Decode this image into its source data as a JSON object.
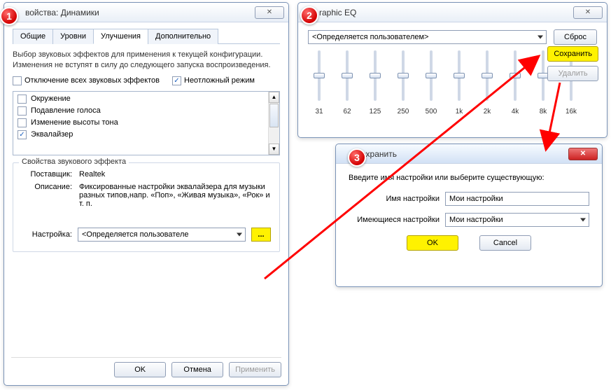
{
  "badges": [
    "1",
    "2",
    "3"
  ],
  "win1": {
    "title": "войства: Динамики",
    "close": "✕",
    "tabs": [
      "Общие",
      "Уровни",
      "Улучшения",
      "Дополнительно"
    ],
    "active_tab": 2,
    "intro": "Выбор звуковых эффектов для применения к текущей конфигурации. Изменения не вступят в силу до следующего запуска воспроизведения.",
    "opt_disable": "Отключение всех звуковых эффектов",
    "opt_urgent": "Неотложный режим",
    "effects": [
      {
        "label": "Окружение",
        "checked": false
      },
      {
        "label": "Подавление голоса",
        "checked": false
      },
      {
        "label": "Изменение высоты тона",
        "checked": false
      },
      {
        "label": "Эквалайзер",
        "checked": true
      }
    ],
    "group_title": "Свойства звукового эффекта",
    "vendor_k": "Поставщик:",
    "vendor_v": "Realtek",
    "desc_k": "Описание:",
    "desc_v": "Фиксированные настройки эквалайзера для музыки разных типов,напр. «Поп», «Живая музыка», «Рок» и т. п.",
    "setting_k": "Настройка:",
    "setting_v": "<Определяется пользователе",
    "dots": "...",
    "ok": "OK",
    "cancel": "Отмена",
    "apply": "Применить"
  },
  "win2": {
    "title": "raphic EQ",
    "close": "✕",
    "preset": "<Определяется пользователем>",
    "reset": "Сброс",
    "save": "Сохранить",
    "delete": "Удалить",
    "bands": [
      "31",
      "62",
      "125",
      "250",
      "500",
      "1k",
      "2k",
      "4k",
      "8k",
      "16k"
    ]
  },
  "win3": {
    "title": "охранить",
    "close": "✕",
    "prompt": "Введите имя настройки или выберите существующую:",
    "name_lbl": "Имя настройки",
    "name_val": "Мои настройки",
    "exist_lbl": "Имеющиеся настройки",
    "exist_val": "Мои настройки",
    "ok": "OK",
    "cancel": "Cancel"
  }
}
